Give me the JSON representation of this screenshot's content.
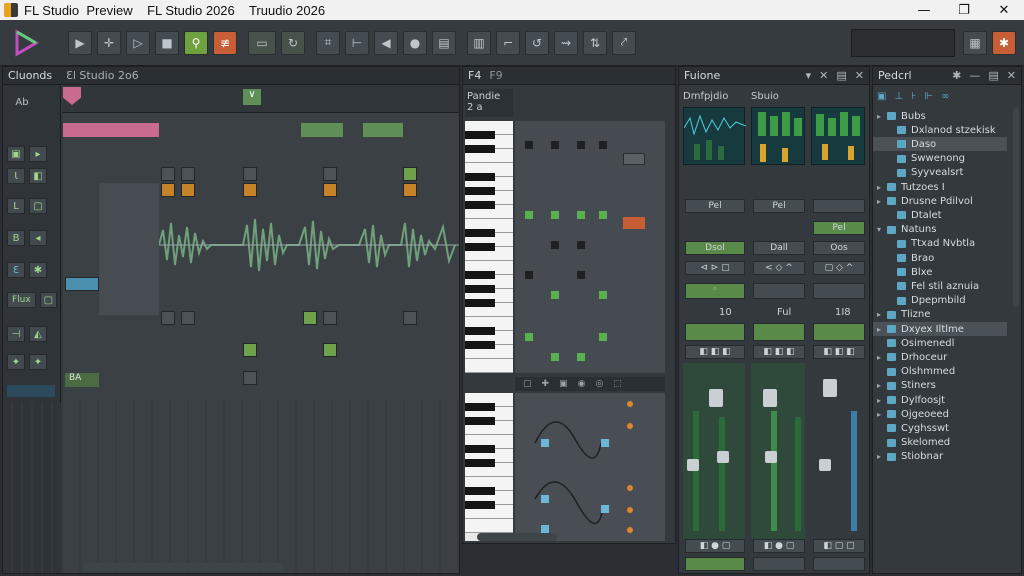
{
  "window": {
    "title": "FL Studio  Preview    FL Studio 2026    Truudio 2026",
    "minimize": "—",
    "maximize": "❐",
    "close": "✕"
  },
  "toolbar": {
    "accent": "#6fa13f",
    "alert": "#c85e35"
  },
  "channel_rack": {
    "title": "Cluonds",
    "subtitle": "Ɛl Studio 2o6",
    "row_labels": [
      "Ab",
      "Ɩ",
      "L",
      "B",
      "Ɛ",
      "Flux",
      "ΒΑ"
    ],
    "selected_label": "BA",
    "bottom_label": "BA"
  },
  "piano_roll": {
    "title": "Pandie",
    "subtitle": "2 a",
    "tab_a": "F4",
    "tab_b": "F9"
  },
  "mixer": {
    "title": "Fuione",
    "header_a": "Dmfpjdio",
    "header_b": "Sbuio",
    "strip_labels": [
      "Pel",
      "Pel",
      "Pel"
    ],
    "send_labels": [
      "Dsol",
      "Dall",
      "Oos"
    ],
    "values": [
      "10",
      "Ful",
      "1I8"
    ]
  },
  "browser": {
    "title": "Pedcrl",
    "items": [
      {
        "label": "Bubs",
        "indent": 1,
        "arrow": "▸",
        "hl": false
      },
      {
        "label": "Dxlanod stzekisk",
        "indent": 2,
        "arrow": "",
        "hl": false
      },
      {
        "label": "Daso",
        "indent": 2,
        "arrow": "",
        "hl": true
      },
      {
        "label": "Swwenong",
        "indent": 2,
        "arrow": "",
        "hl": false
      },
      {
        "label": "Syyvealsrt",
        "indent": 2,
        "arrow": "",
        "hl": false
      },
      {
        "label": "Tutzoes I",
        "indent": 1,
        "arrow": "▸",
        "hl": false
      },
      {
        "label": "Drusne Pdilvol",
        "indent": 1,
        "arrow": "▸",
        "hl": false
      },
      {
        "label": "Dtalet",
        "indent": 2,
        "arrow": "",
        "hl": false
      },
      {
        "label": "Natuns",
        "indent": 1,
        "arrow": "▾",
        "hl": false
      },
      {
        "label": "Ttxad Nvbtla",
        "indent": 2,
        "arrow": "",
        "hl": false
      },
      {
        "label": "Brao",
        "indent": 2,
        "arrow": "",
        "hl": false
      },
      {
        "label": "Blxe",
        "indent": 2,
        "arrow": "",
        "hl": false
      },
      {
        "label": "Fel stil aznuia",
        "indent": 2,
        "arrow": "",
        "hl": false
      },
      {
        "label": "Dpepmbild",
        "indent": 2,
        "arrow": "",
        "hl": false
      },
      {
        "label": "Tlizne",
        "indent": 1,
        "arrow": "▸",
        "hl": false
      },
      {
        "label": "Dxyex Iltlme",
        "indent": 1,
        "arrow": "▸",
        "hl": true
      },
      {
        "label": "Osimenedl",
        "indent": 1,
        "arrow": "",
        "hl": false
      },
      {
        "label": "Drhoceur",
        "indent": 1,
        "arrow": "▸",
        "hl": false
      },
      {
        "label": "Olshmmed",
        "indent": 1,
        "arrow": "",
        "hl": false
      },
      {
        "label": "Stiners",
        "indent": 1,
        "arrow": "▸",
        "hl": false
      },
      {
        "label": "Dylfoosjt",
        "indent": 1,
        "arrow": "▸",
        "hl": false
      },
      {
        "label": "Ojgeoeed",
        "indent": 1,
        "arrow": "▸",
        "hl": false
      },
      {
        "label": "Cyghsswt",
        "indent": 1,
        "arrow": "",
        "hl": false
      },
      {
        "label": "Skelomed",
        "indent": 1,
        "arrow": "",
        "hl": false
      },
      {
        "label": "Stiobnar",
        "indent": 1,
        "arrow": "▸",
        "hl": false
      }
    ]
  }
}
